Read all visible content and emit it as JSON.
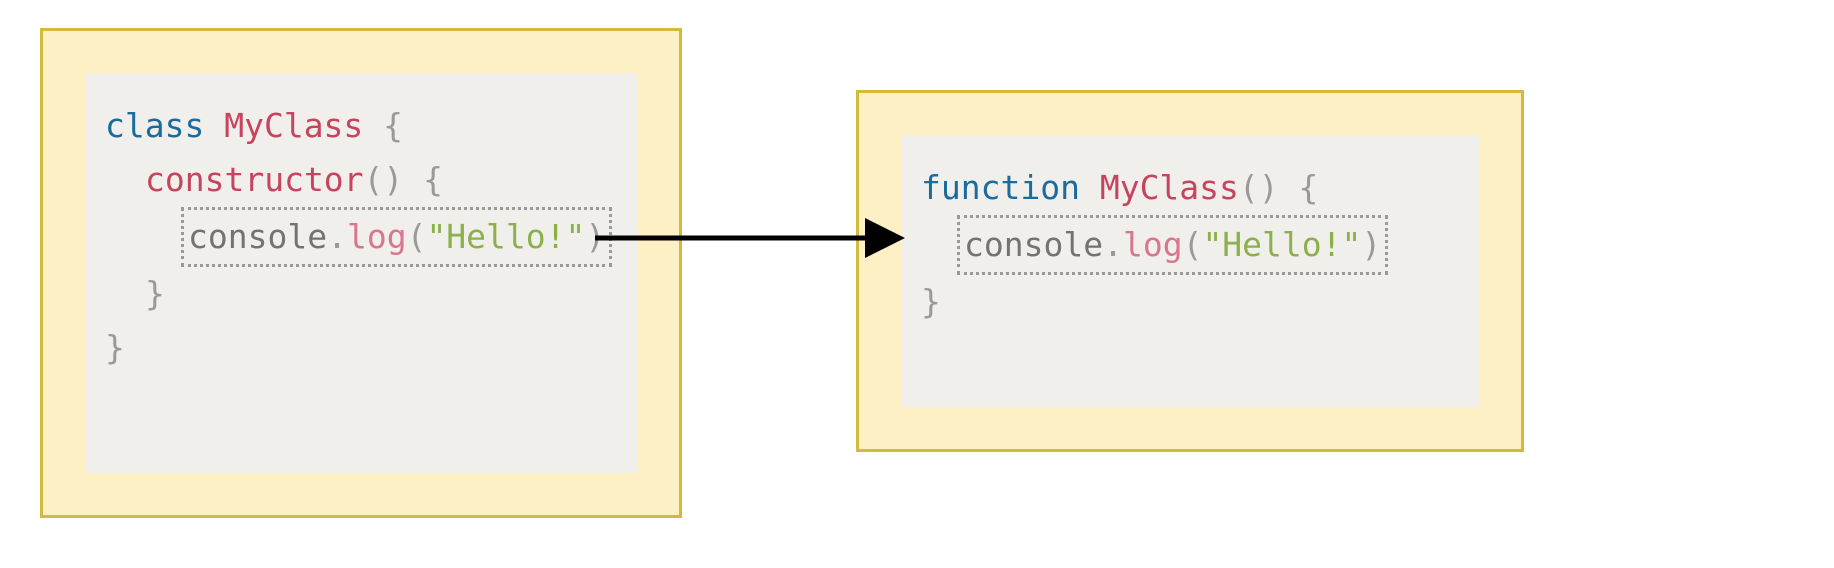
{
  "colors": {
    "box_bg": "#fdf0c4",
    "box_border": "#d4b93f",
    "inner_bg": "#f0efeb",
    "keyword": "#1a6b9e",
    "classname": "#c7445e",
    "method": "#c7445e",
    "punct": "#999999",
    "identifier": "#737373",
    "func": "#d9758f",
    "string": "#8cb04a",
    "dotted": "#999999"
  },
  "left": {
    "line1": {
      "keyword": "class",
      "space": " ",
      "name": "MyClass",
      "brace": " {"
    },
    "line2": {
      "method": "constructor",
      "parens": "()",
      "brace": " {"
    },
    "line3": {
      "obj": "console",
      "dot": ".",
      "func": "log",
      "open": "(",
      "string": "\"Hello!\"",
      "close": ")"
    },
    "line4": {
      "brace": "}"
    },
    "line5": {
      "brace": "}"
    }
  },
  "right": {
    "line1": {
      "keyword": "function",
      "space": " ",
      "name": "MyClass",
      "parens": "()",
      "brace": " {"
    },
    "line2": {
      "obj": "console",
      "dot": ".",
      "func": "log",
      "open": "(",
      "string": "\"Hello!\"",
      "close": ")"
    },
    "line3": {
      "brace": "}"
    }
  }
}
